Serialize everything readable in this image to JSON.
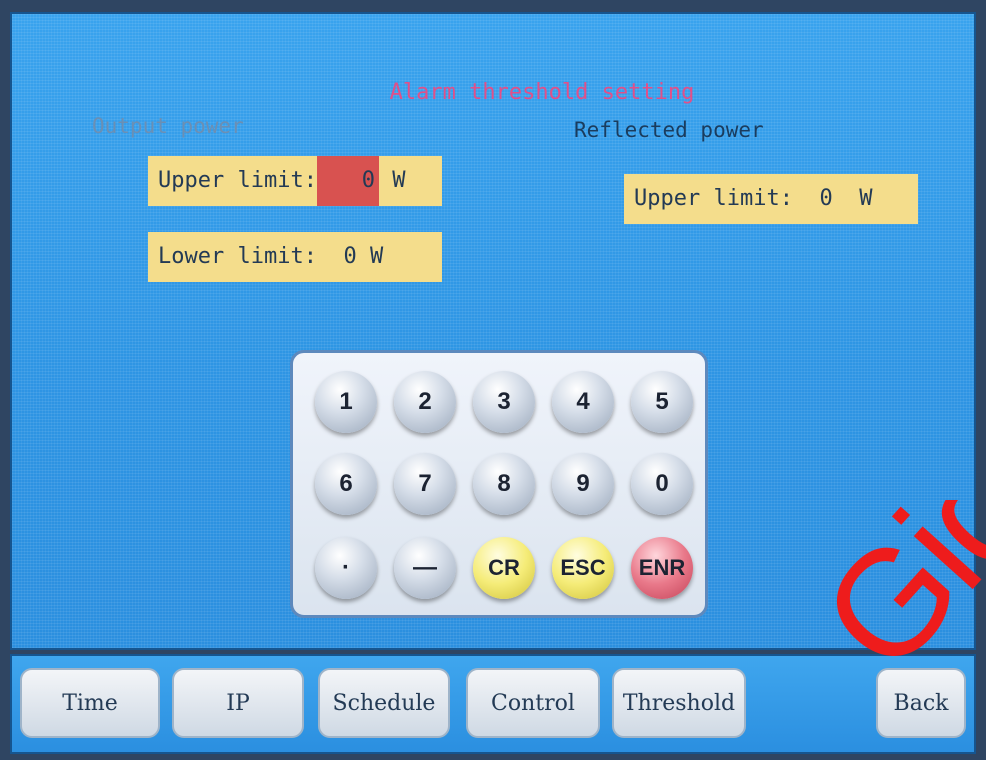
{
  "screen": {
    "title": "Alarm threshold setting",
    "output_power": {
      "label": "Output power",
      "upper_label": "Upper limit:",
      "upper_value": "0",
      "upper_unit": "W",
      "lower_label": "Lower limit:",
      "lower_value": "0",
      "lower_unit": "W"
    },
    "reflected_power": {
      "label": "Reflected power",
      "upper_label": "Upper limit:",
      "upper_value": "0",
      "upper_unit": "W"
    }
  },
  "keypad": {
    "keys": [
      "1",
      "2",
      "3",
      "4",
      "5",
      "6",
      "7",
      "8",
      "9",
      "0",
      "·",
      "—",
      "CR",
      "ESC",
      "ENR"
    ]
  },
  "tabs": [
    "Time",
    "IP",
    "Schedule",
    "Control",
    "Threshold",
    "Back"
  ],
  "watermark": {
    "text": "Giga"
  },
  "colors": {
    "accent_title": "#e0508a",
    "field_bg": "#f4dd8c",
    "active_cell": "#d85250",
    "screen_bg": "#2e95e4"
  }
}
